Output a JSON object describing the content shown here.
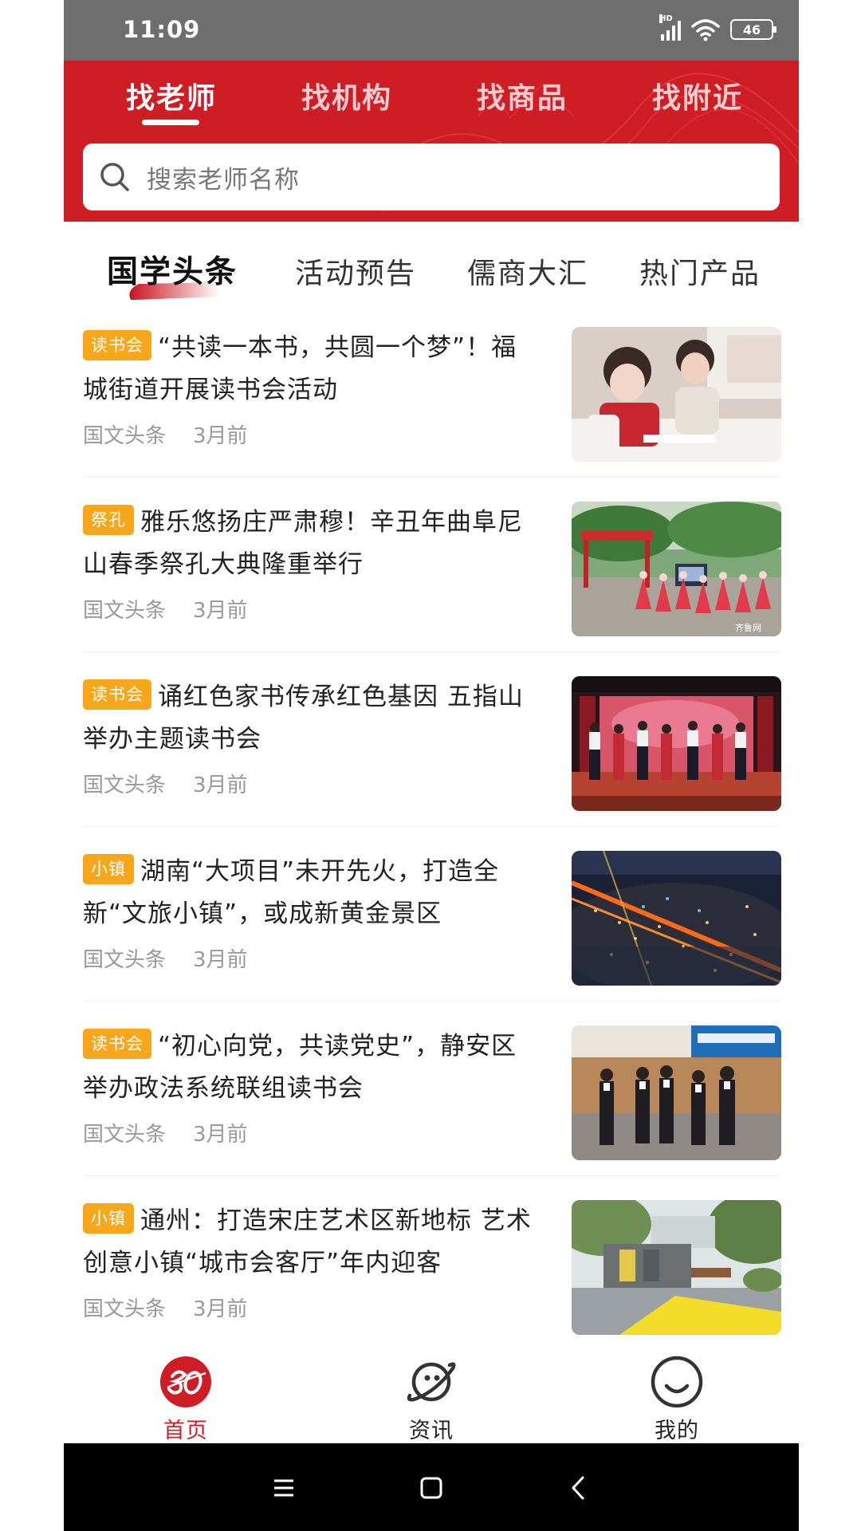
{
  "status_bar": {
    "time": "11:09",
    "network": "HD",
    "battery": "46"
  },
  "top_tabs": [
    {
      "label": "找老师",
      "active": true
    },
    {
      "label": "找机构",
      "active": false
    },
    {
      "label": "找商品",
      "active": false
    },
    {
      "label": "找附近",
      "active": false
    }
  ],
  "search": {
    "placeholder": "搜索老师名称",
    "icon": "search-icon"
  },
  "category_tabs": [
    {
      "label": "国学头条",
      "active": true
    },
    {
      "label": "活动预告",
      "active": false
    },
    {
      "label": "儒商大汇",
      "active": false
    },
    {
      "label": "热门产品",
      "active": false
    }
  ],
  "news": [
    {
      "tag": "读书会",
      "title": "“共读一本书，共圆一个梦”！福城街道开展读书会活动",
      "source": "国文头条",
      "time": "3月前"
    },
    {
      "tag": "祭孔",
      "title": "雅乐悠扬庄严肃穆！辛丑年曲阜尼山春季祭孔大典隆重举行",
      "source": "国文头条",
      "time": "3月前"
    },
    {
      "tag": "读书会",
      "title": "诵红色家书传承红色基因 五指山举办主题读书会",
      "source": "国文头条",
      "time": "3月前"
    },
    {
      "tag": "小镇",
      "title": "湖南“大项目”未开先火，打造全新“文旅小镇”，或成新黄金景区",
      "source": "国文头条",
      "time": "3月前"
    },
    {
      "tag": "读书会",
      "title": "“初心向党，共读党史”，静安区举办政法系统联组读书会",
      "source": "国文头条",
      "time": "3月前"
    },
    {
      "tag": "小镇",
      "title": "通州：打造宋庄艺术区新地标 艺术创意小镇“城市会客厅”年内迎客",
      "source": "国文头条",
      "time": "3月前"
    }
  ],
  "image_watermark": "齐鲁网",
  "bottom_nav": [
    {
      "label": "首页",
      "icon": "home-logo-icon",
      "active": true
    },
    {
      "label": "资讯",
      "icon": "planet-icon",
      "active": false
    },
    {
      "label": "我的",
      "icon": "smiley-profile-icon",
      "active": false
    }
  ],
  "system_nav": [
    "menu-icon",
    "home-square-icon",
    "back-icon"
  ],
  "colors": {
    "brand_red": "#cf1d26",
    "tag_orange": "#f6a71c",
    "status_bar": "#6e6e6e"
  }
}
